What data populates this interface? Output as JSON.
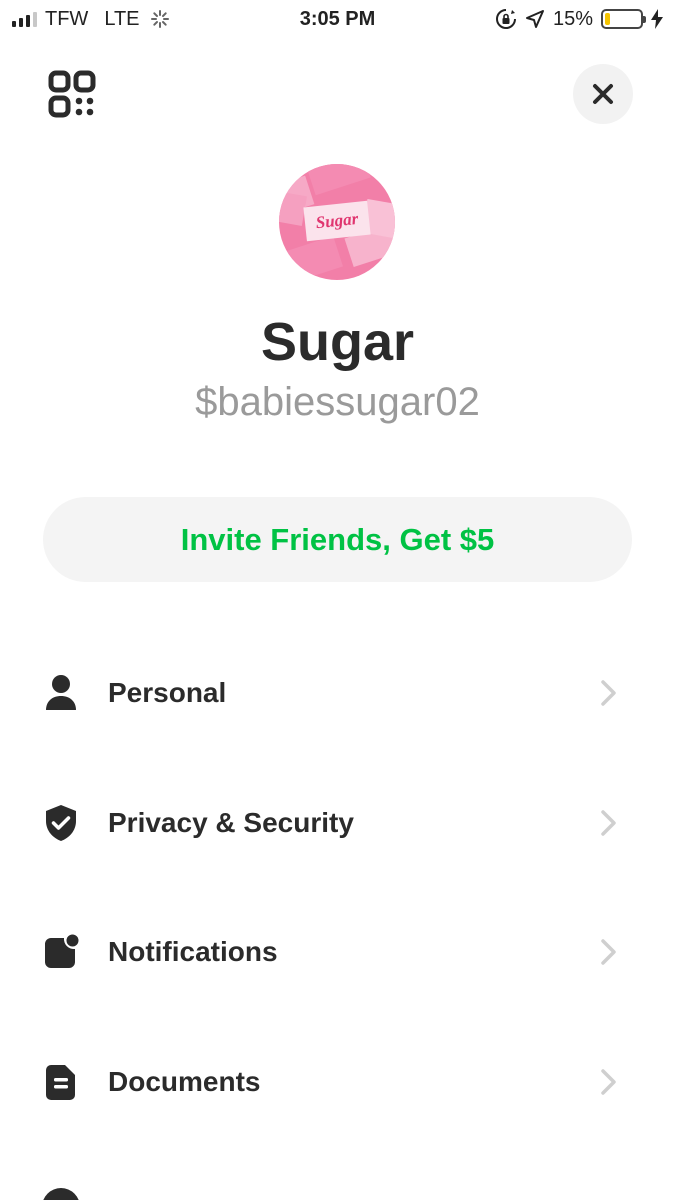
{
  "status_bar": {
    "carrier": "TFW",
    "network": "LTE",
    "time": "3:05 PM",
    "battery_percent": "15%",
    "battery_level": 0.15,
    "battery_color": "#f5c400"
  },
  "header": {
    "left_icon": "qr-code-icon",
    "right_icon": "close-icon"
  },
  "profile": {
    "name": "Sugar",
    "cashtag": "$babiessugar02",
    "avatar_text": "Sugar"
  },
  "invite": {
    "label": "Invite Friends, Get $5",
    "color": "#00c244"
  },
  "menu": {
    "items": [
      {
        "label": "Personal",
        "icon": "person-icon"
      },
      {
        "label": "Privacy & Security",
        "icon": "shield-check-icon"
      },
      {
        "label": "Notifications",
        "icon": "notification-badge-icon"
      },
      {
        "label": "Documents",
        "icon": "document-icon"
      }
    ]
  }
}
